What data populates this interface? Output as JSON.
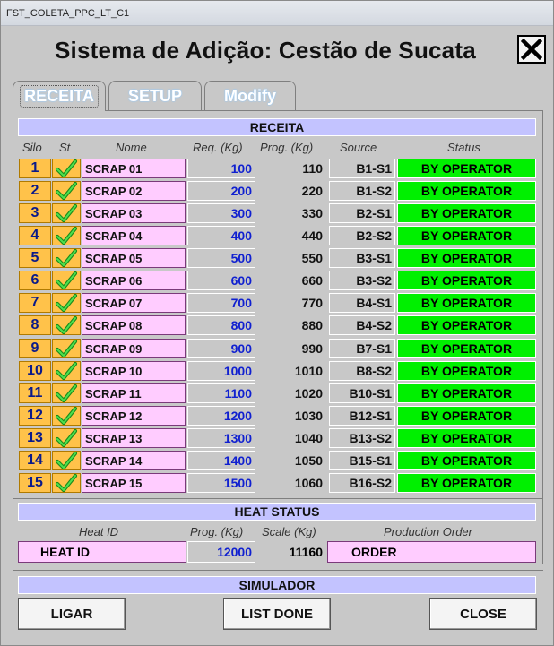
{
  "window": {
    "title": "FST_COLETA_PPC_LT_C1"
  },
  "header": {
    "title": "Sistema de Adição: Cestão de Sucata"
  },
  "tabs": [
    {
      "label": "RECEITA"
    },
    {
      "label": "SETUP"
    },
    {
      "label": "Modify"
    }
  ],
  "receita": {
    "section_title": "RECEITA",
    "columns": {
      "silo": "Silo",
      "st": "St",
      "nome": "Nome",
      "req": "Req. (Kg)",
      "prog": "Prog. (Kg)",
      "source": "Source",
      "status": "Status"
    },
    "rows": [
      {
        "silo": "1",
        "nome": "SCRAP 01",
        "req": "100",
        "prog": "110",
        "source": "B1-S1",
        "status": "BY OPERATOR"
      },
      {
        "silo": "2",
        "nome": "SCRAP 02",
        "req": "200",
        "prog": "220",
        "source": "B1-S2",
        "status": "BY OPERATOR"
      },
      {
        "silo": "3",
        "nome": "SCRAP 03",
        "req": "300",
        "prog": "330",
        "source": "B2-S1",
        "status": "BY OPERATOR"
      },
      {
        "silo": "4",
        "nome": "SCRAP 04",
        "req": "400",
        "prog": "440",
        "source": "B2-S2",
        "status": "BY OPERATOR"
      },
      {
        "silo": "5",
        "nome": "SCRAP 05",
        "req": "500",
        "prog": "550",
        "source": "B3-S1",
        "status": "BY OPERATOR"
      },
      {
        "silo": "6",
        "nome": "SCRAP 06",
        "req": "600",
        "prog": "660",
        "source": "B3-S2",
        "status": "BY OPERATOR"
      },
      {
        "silo": "7",
        "nome": "SCRAP 07",
        "req": "700",
        "prog": "770",
        "source": "B4-S1",
        "status": "BY OPERATOR"
      },
      {
        "silo": "8",
        "nome": "SCRAP 08",
        "req": "800",
        "prog": "880",
        "source": "B4-S2",
        "status": "BY OPERATOR"
      },
      {
        "silo": "9",
        "nome": "SCRAP 09",
        "req": "900",
        "prog": "990",
        "source": "B7-S1",
        "status": "BY OPERATOR"
      },
      {
        "silo": "10",
        "nome": "SCRAP 10",
        "req": "1000",
        "prog": "1010",
        "source": "B8-S2",
        "status": "BY OPERATOR"
      },
      {
        "silo": "11",
        "nome": "SCRAP 11",
        "req": "1100",
        "prog": "1020",
        "source": "B10-S1",
        "status": "BY OPERATOR"
      },
      {
        "silo": "12",
        "nome": "SCRAP 12",
        "req": "1200",
        "prog": "1030",
        "source": "B12-S1",
        "status": "BY OPERATOR"
      },
      {
        "silo": "13",
        "nome": "SCRAP 13",
        "req": "1300",
        "prog": "1040",
        "source": "B13-S2",
        "status": "BY OPERATOR"
      },
      {
        "silo": "14",
        "nome": "SCRAP 14",
        "req": "1400",
        "prog": "1050",
        "source": "B15-S1",
        "status": "BY OPERATOR"
      },
      {
        "silo": "15",
        "nome": "SCRAP 15",
        "req": "1500",
        "prog": "1060",
        "source": "B16-S2",
        "status": "BY OPERATOR"
      }
    ]
  },
  "heat_status": {
    "section_title": "HEAT STATUS",
    "columns": {
      "heat_id": "Heat ID",
      "prog": "Prog. (Kg)",
      "scale": "Scale (Kg)",
      "order": "Production Order"
    },
    "heat_id": "HEAT ID",
    "prog": "12000",
    "scale": "11160",
    "order": "ORDER"
  },
  "simulador": {
    "section_title": "SIMULADOR",
    "buttons": {
      "ligar": "LIGAR",
      "list_done": "LIST DONE",
      "close": "CLOSE"
    }
  },
  "colors": {
    "silo_cell": "#ffc24a",
    "name_cell": "#ffccff",
    "status_ok": "#00f000",
    "section_bar": "#c3c3ff",
    "req_value": "#1020d0"
  },
  "icons": {
    "status_check": "check-icon",
    "close": "close-icon"
  }
}
